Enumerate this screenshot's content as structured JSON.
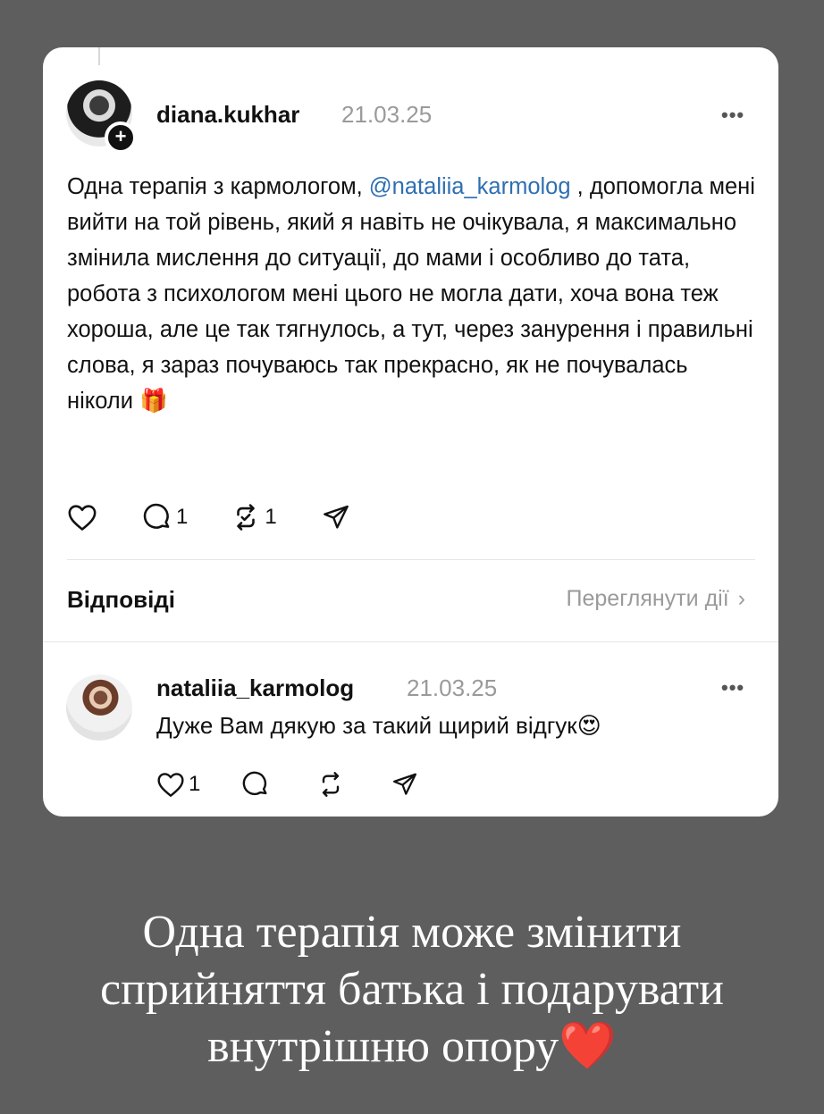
{
  "post": {
    "author": "diana.kukhar",
    "date": "21.03.25",
    "more_label": "•••",
    "follow_badge": "+",
    "text_before_mention": "Одна терапія з кармологом, ",
    "mention": "@nataliia_karmolog",
    "text_after_mention": " , допомогла мені вийти на той рівень, який я навіть не очікувала, я максимально змінила мислення до ситуації, до мами і особливо до тата, робота з психологом мені цього не могла дати, хоча вона теж хороша, але це так тягнулось, а тут, через занурення і правильні слова, я зараз почуваюсь так прекрасно, як не почувалась ніколи 🎁",
    "comment_count": "1",
    "repost_count": "1",
    "icons": [
      "heart-icon",
      "comment-icon",
      "repost-icon",
      "share-icon"
    ]
  },
  "replies_section": {
    "title": "Відповіді",
    "view_activity": "Переглянути дії",
    "chevron": "›"
  },
  "reply": {
    "author": "nataliia_karmolog",
    "date": "21.03.25",
    "more_label": "•••",
    "text": "Дуже Вам дякую за такий щирий відгук😍",
    "like_count": "1"
  },
  "caption": {
    "line1": "Одна терапія може змінити",
    "line2": "сприйняття батька і подарувати",
    "line3": "внутрішню опору❤️"
  }
}
